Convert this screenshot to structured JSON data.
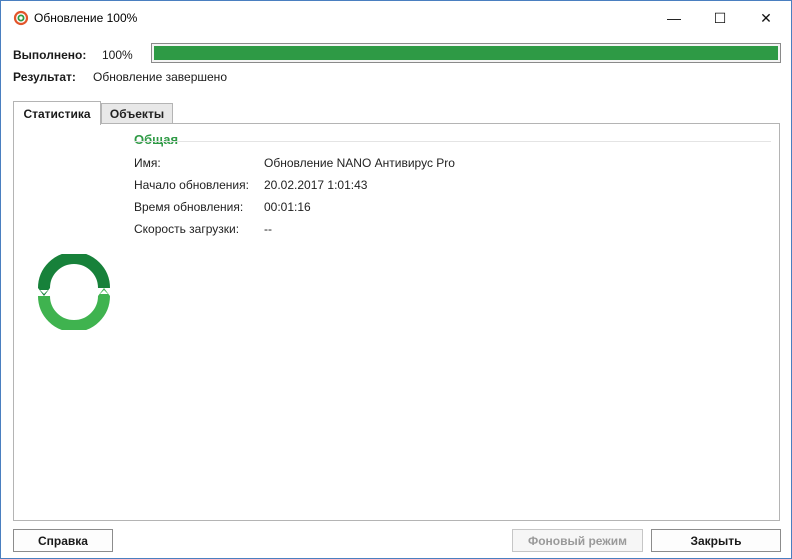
{
  "window": {
    "title": "Обновление 100%",
    "controls": {
      "minimize": "—",
      "maximize": "☐",
      "close": "✕"
    }
  },
  "status": {
    "done_label": "Выполнено:",
    "done_value": "100%",
    "progress": 1.0,
    "result_label": "Результат:",
    "result_value": "Обновление завершено"
  },
  "tabs": [
    {
      "label": "Статистика",
      "active": true
    },
    {
      "label": "Объекты",
      "active": false
    }
  ],
  "section": {
    "title": "Общая",
    "fields": [
      {
        "label": "Имя:",
        "value": "Обновление NANO Антивирус Pro"
      },
      {
        "label": "Начало обновления:",
        "value": "20.02.2017 1:01:43"
      },
      {
        "label": "Время обновления:",
        "value": "00:01:16"
      },
      {
        "label": "Скорость загрузки:",
        "value": "--"
      }
    ]
  },
  "buttons": {
    "help": "Справка",
    "background": "Фоновый режим",
    "close": "Закрыть"
  },
  "colors": {
    "accent_green": "#2e9a45",
    "logo_dark": "#17813a",
    "logo_light": "#3fb34f"
  },
  "icons": {
    "app": "nano-app-icon",
    "logo": "refresh-logo-icon"
  }
}
